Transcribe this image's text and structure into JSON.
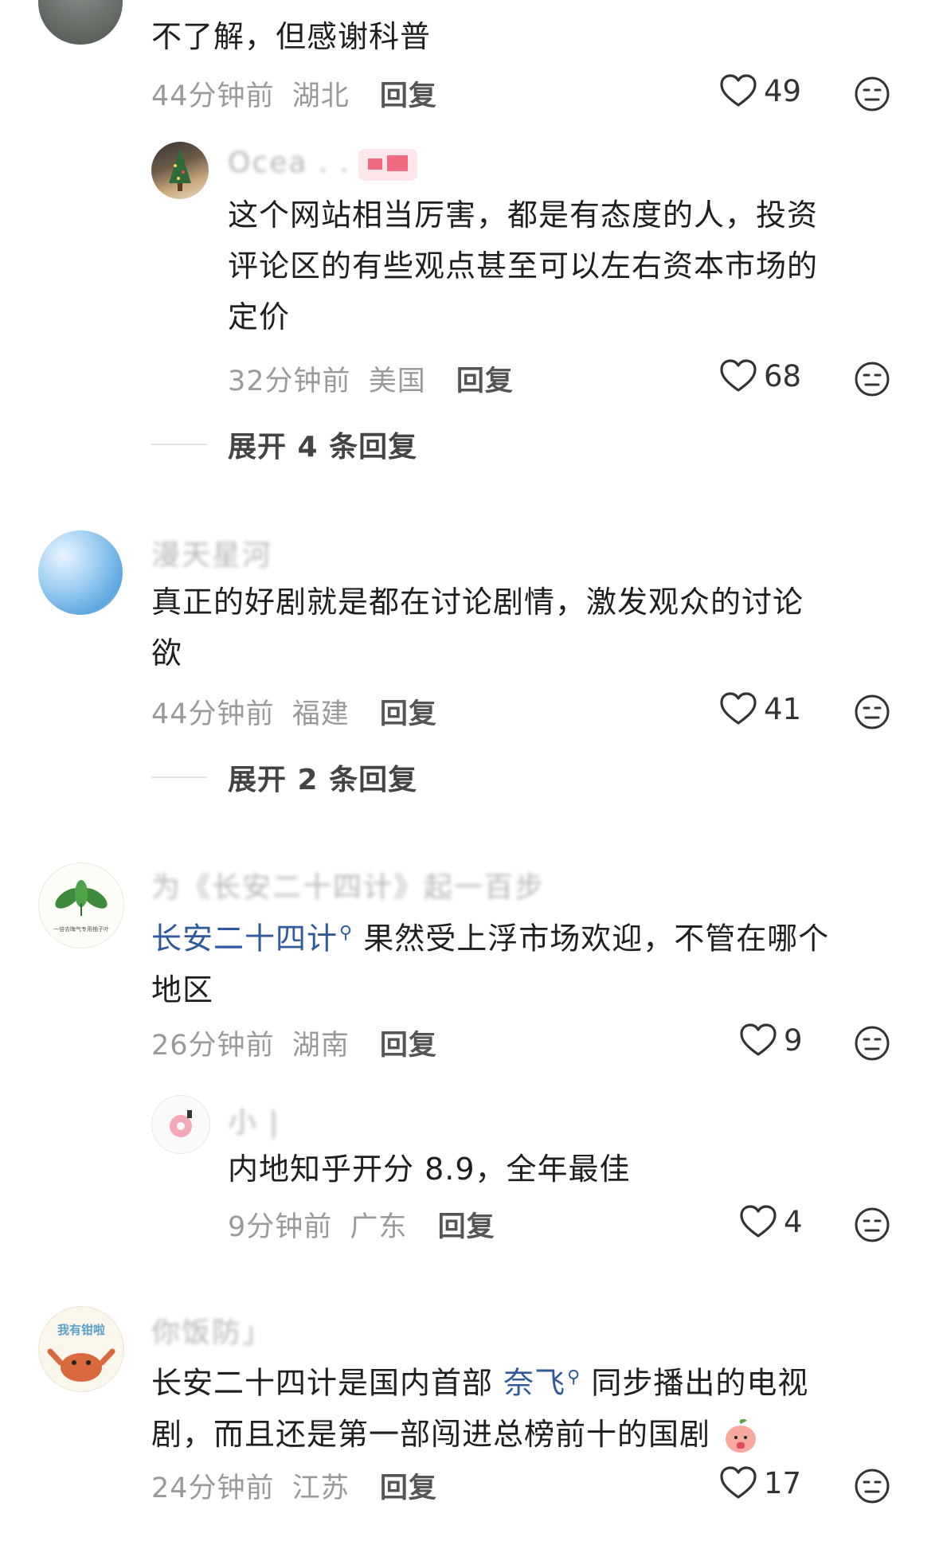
{
  "comments": [
    {
      "text": "不了解，但感谢科普",
      "time": "44分钟前",
      "region": "湖北",
      "reply_label": "回复",
      "likes": "49",
      "replies": [
        {
          "username": "Ocea . .",
          "text_lines": [
            "这个网站相当厉害，都是有态度的人，投资",
            "评论区的有些观点甚至可以左右资本市场的",
            "定价"
          ],
          "time": "32分钟前",
          "region": "美国",
          "reply_label": "回复",
          "likes": "68"
        }
      ],
      "expand_label": "展开 4 条回复"
    },
    {
      "username": "漫天星河",
      "text_lines": [
        "真正的好剧就是都在讨论剧情，激发观众的讨论",
        "欲"
      ],
      "time": "44分钟前",
      "region": "福建",
      "reply_label": "回复",
      "likes": "41",
      "expand_label": "展开 2 条回复"
    },
    {
      "username": "为《长安二十四计》起一百步",
      "link_text": "长安二十四计",
      "text_rest": "果然受上浮市场欢迎，不管在哪个",
      "text_line2": "地区",
      "time": "26分钟前",
      "region": "湖南",
      "reply_label": "回复",
      "likes": "9",
      "replies": [
        {
          "username": "小 |",
          "text": "内地知乎开分 8.9，全年最佳",
          "time": "9分钟前",
          "region": "广东",
          "reply_label": "回复",
          "likes": "4"
        }
      ]
    },
    {
      "username": "你饭防」",
      "text_pre": "长安二十四计是国内首部",
      "link_text": "奈飞",
      "text_post": "同步播出的电视",
      "text_line2": "剧，而且还是第一部闯进总榜前十的国剧",
      "time": "24分钟前",
      "region": "江苏",
      "reply_label": "回复",
      "likes": "17"
    }
  ],
  "avatar_texts": {
    "yuzi_caption": "一倍去晦气专用柚子叶",
    "crab_caption": "我有钳啦"
  },
  "colors": {
    "meta_gray": "#9a9a9a",
    "link_blue": "#2f5a9b",
    "author_tag": "#f06b82"
  }
}
